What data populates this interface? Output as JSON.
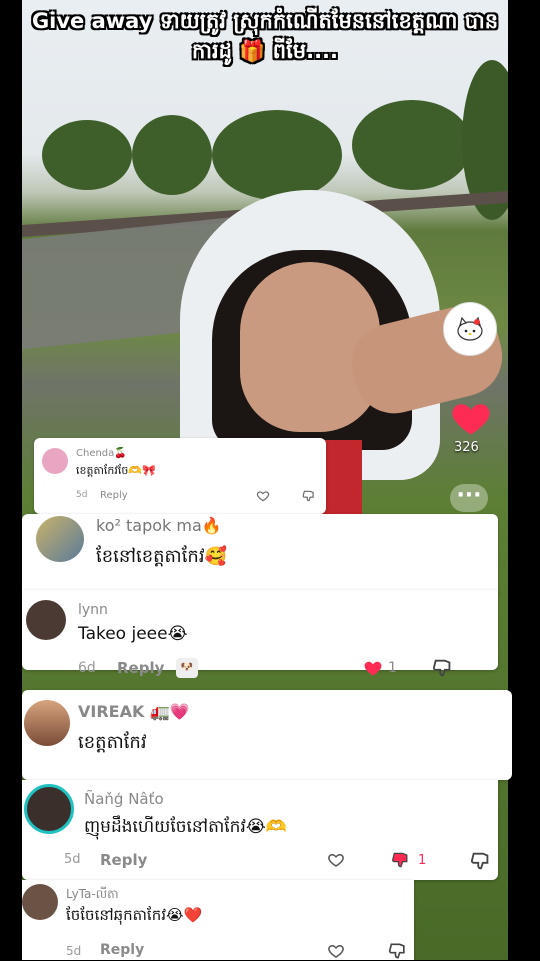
{
  "video": {
    "caption": "Give away ទាយត្រូវ ស្រុកកំណើតមែននៅខេត្តណា បានការដូ 🎁 ពីមែ....",
    "shop_avatar_label": "hello kitty",
    "like_count": "326"
  },
  "comments": [
    {
      "user": "Chenda🍒",
      "text": "ខេត្តតាកែវចែ🫶🎀",
      "time": "5d",
      "reply": "Reply"
    },
    {
      "user": "ko² tapok ma🔥",
      "text": "ខែនៅខេត្តតាកែវ🥰"
    },
    {
      "user": "lynn",
      "text": "Takeo jeee😭",
      "time": "6d",
      "reply": "Reply",
      "like_count": "1"
    },
    {
      "user": "VIREAK 🚛💗",
      "text": "ខេត្តតាកែវ"
    },
    {
      "user": "Ñaňģ Nâťo",
      "text": "ញុមដឹងហើយចែនៅតាកែវ😭🫶",
      "time": "5d",
      "reply": "Reply",
      "dislike_count": "1"
    },
    {
      "user": "LyTa-លីតា",
      "text": "ចែចែនៅឆុកតាកែវ😭❤️",
      "time": "5d",
      "reply": "Reply"
    }
  ],
  "colors": {
    "heart": "#fe2c55",
    "card_bg": "#ffffff"
  }
}
